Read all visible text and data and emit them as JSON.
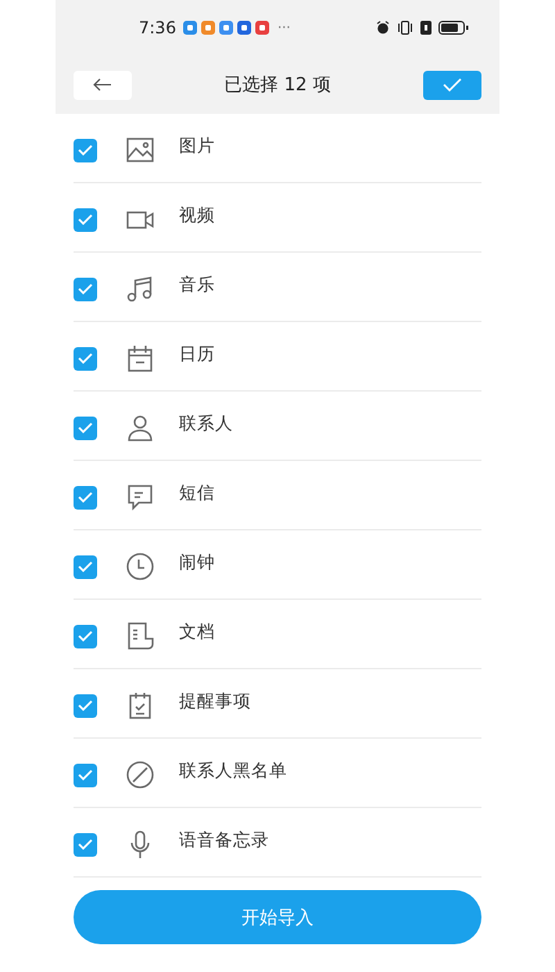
{
  "status_bar": {
    "time": "7:36",
    "more": "···"
  },
  "header": {
    "title": "已选择 12 项"
  },
  "items": [
    {
      "label": "图片",
      "kind": "picture",
      "checked": true
    },
    {
      "label": "视频",
      "kind": "video",
      "checked": true
    },
    {
      "label": "音乐",
      "kind": "music",
      "checked": true
    },
    {
      "label": "日历",
      "kind": "calendar",
      "checked": true
    },
    {
      "label": "联系人",
      "kind": "contact",
      "checked": true
    },
    {
      "label": "短信",
      "kind": "message",
      "checked": true
    },
    {
      "label": "闹钟",
      "kind": "clock",
      "checked": true
    },
    {
      "label": "文档",
      "kind": "document",
      "checked": true
    },
    {
      "label": "提醒事项",
      "kind": "reminder",
      "checked": true
    },
    {
      "label": "联系人黑名单",
      "kind": "blocked",
      "checked": true
    },
    {
      "label": "语音备忘录",
      "kind": "voice",
      "checked": true
    }
  ],
  "import_button": {
    "label": "开始导入"
  }
}
